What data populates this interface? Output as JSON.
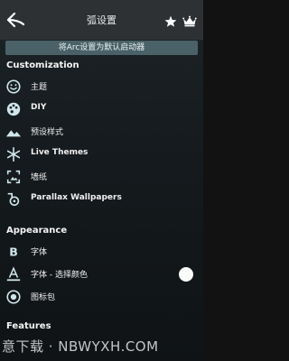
{
  "header": {
    "title": "弧设置",
    "back_icon": "back-arrow-icon",
    "star_icon": "star-icon",
    "crown_icon": "crown-icon"
  },
  "default_bar": {
    "label": "将Arc设置为默认启动器"
  },
  "sections": {
    "customization": "Customization",
    "appearance": "Appearance",
    "features": "Features"
  },
  "customization_items": [
    {
      "label": "主题",
      "icon": "smiley-face-icon"
    },
    {
      "label": "DIY",
      "icon": "palette-icon"
    },
    {
      "label": "预设样式",
      "icon": "landscape-icon"
    },
    {
      "label": "Live Themes",
      "icon": "snowflake-icon"
    },
    {
      "label": "墙纸",
      "icon": "wallpaper-icon"
    },
    {
      "label": "Parallax Wallpapers",
      "icon": "parallax-icon"
    }
  ],
  "appearance_items": [
    {
      "label": "字体",
      "icon": "font-b-icon"
    },
    {
      "label": "字体 - 选择颜色",
      "icon": "font-color-icon",
      "toggle_on": true
    },
    {
      "label": "图标包",
      "icon": "icon-pack-icon"
    }
  ],
  "watermark": "意下载 · NBWYXH.COM",
  "colors": {
    "accent": "#4a6267",
    "icon": "#cfe6ea"
  }
}
